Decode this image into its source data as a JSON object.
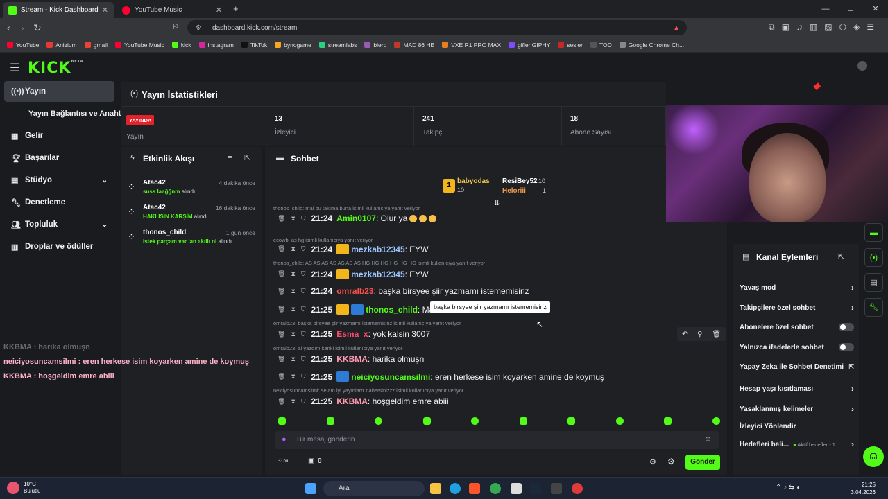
{
  "browser": {
    "tabs": [
      {
        "label": "Stream - Kick Dashboard",
        "active": true
      },
      {
        "label": "YouTube Music",
        "active": false
      }
    ],
    "url": "dashboard.kick.com/stream",
    "bookmarks": [
      "YouTube",
      "Anizium",
      "gmail",
      "YouTube Music",
      "kick",
      "instagram",
      "TikTok",
      "bynogame",
      "streamlabs",
      "blerp",
      "MAD 86 HE",
      "VXE R1 PRO MAX",
      "gifler GIPHY",
      "sesler",
      "TOD",
      "Google Chrome Ch..."
    ]
  },
  "sidebar": {
    "items": [
      {
        "label": "Yayın",
        "icon": "broadcast-icon"
      },
      {
        "label": "Yayın Bağlantısı ve Anahtarı"
      },
      {
        "label": "Gelir",
        "icon": "chart-icon"
      },
      {
        "label": "Başarılar",
        "icon": "trophy-icon"
      },
      {
        "label": "Stüdyo",
        "icon": "studio-icon"
      },
      {
        "label": "Denetleme",
        "icon": "wrench-icon"
      },
      {
        "label": "Topluluk",
        "icon": "users-icon"
      },
      {
        "label": "Droplar ve ödüller",
        "icon": "drops-icon"
      }
    ]
  },
  "stats": {
    "title": "Yayın İstatistikleri",
    "live_badge": "YAYINDA",
    "live_label": "Yayın",
    "viewers_value": "13",
    "viewers_label": "İzleyici",
    "followers_value": "241",
    "followers_label": "Takipçi",
    "subs_value": "18",
    "subs_label": "Abone Sayısı"
  },
  "events": {
    "title": "Etkinlik Akışı",
    "items": [
      {
        "user": "Atac42",
        "time": "4 dakika önce",
        "reward": "suss laağğnm",
        "suffix": "alındı"
      },
      {
        "user": "Atac42",
        "time": "16 dakika önce",
        "reward": "HAKLISIN KARŞİM",
        "suffix": "alındı"
      },
      {
        "user": "thonos_child",
        "time": "1 gün önce",
        "reward": "istek parçam var lan akıllı ol",
        "suffix": "alındı"
      }
    ]
  },
  "chat": {
    "title": "Sohbet",
    "top": {
      "first": "babyodas",
      "first_count": "10",
      "second": "ResiBey52",
      "second_count": "10",
      "third": "Heloriii",
      "third_count": "1"
    },
    "lines": [
      {
        "reply": "thonos_child: mal bu takıma buna isimli kullanıcıya yanıt veriyor",
        "time": "21:24",
        "user": "Amin0107",
        "text": ": Olur ya",
        "color": "#53fc18"
      },
      {
        "reply": "ecowb: as hg isimli kullanıcıya yanıt veriyor",
        "time": "21:24",
        "user": "mezkab12345",
        "text": ": EYW",
        "color": "#9ec7ff"
      },
      {
        "reply": "thonos_child: AS AS AS AS AS AS AS HG HG HG HG HG HG isimli kullanıcıya yanıt veriyor",
        "time": "21:24",
        "user": "mezkab12345",
        "text": ": EYW",
        "color": "#9ec7ff"
      },
      {
        "reply": "",
        "time": "21:24",
        "user": "omralb23",
        "text": ": başka birsyee şiir yazmamı istememisinz",
        "color": "#ff4d4d"
      },
      {
        "reply": "",
        "time": "21:25",
        "user": "thonos_child",
        "text": ": Mals",
        "color": "#53fc18"
      },
      {
        "reply": "omralb23: başka birsyee şiir yazmamı istememisinz isimli kullanıcıya yanıt veriyor",
        "time": "21:25",
        "user": "Esma_x",
        "text": ": yok kalsin 3007",
        "color": "#ff4d6d"
      },
      {
        "reply": "omralb23: al yazdım kanki isimli kullanıcıya yanıt veriyor",
        "time": "21:25",
        "user": "KKBMA",
        "text": ": harika olmuşn",
        "color": "#ff9ab3"
      },
      {
        "reply": "",
        "time": "21:25",
        "user": "neiciyosuncamsilmi",
        "text": ": eren herkese isim koyarken amine de koymuş",
        "color": "#53fc18"
      },
      {
        "reply": "neiciyosuncamsilmi: selam iyi yayınlarrr nabersinizzz isimli kullanıcıya yanıt veriyor",
        "time": "21:25",
        "user": "KKBMA",
        "text": ": hoşgeldim emre abiii",
        "color": "#ff9ab3"
      }
    ],
    "tooltip": "başka birsyee şiir yazmamı istememisinz",
    "input_placeholder": "Bir mesaj gönderin",
    "send_label": "Gönder",
    "footer_count": "0"
  },
  "actions": {
    "title": "Kanal Eylemleri",
    "items": [
      {
        "label": "Yavaş mod",
        "control": "chevron"
      },
      {
        "label": "Takipçilere özel sohbet",
        "control": "chevron"
      },
      {
        "label": "Abonelere özel sohbet",
        "control": "toggle"
      },
      {
        "label": "Yalnızca ifadelerle sohbet",
        "control": "toggle"
      },
      {
        "label": "Yapay Zeka ile Sohbet Denetimi",
        "control": "external"
      },
      {
        "label": "Hesap yaşı kısıtlaması",
        "control": "chevron"
      },
      {
        "label": "Yasaklanmış kelimeler",
        "control": "chevron"
      },
      {
        "label": "İzleyici Yönlendir",
        "control": "none"
      },
      {
        "label": "Hedefleri beli...",
        "control": "chevron"
      }
    ],
    "goals_status": "Aktif hedefler - 1"
  },
  "overlay_chat": [
    {
      "text": "KKBMA : harika olmuşn"
    },
    {
      "text": "neiciyosuncamsilmi : eren herkese isim koyarken amine de koymuş"
    },
    {
      "text": "KKBMA : hoşgeldim emre abiii"
    }
  ],
  "taskbar": {
    "weather_temp": "10°C",
    "weather_desc": "Bulutlu",
    "search": "Ara",
    "time": "21:25",
    "date": "3.04.2026"
  },
  "colors": {
    "accent": "#53fc18",
    "live": "#e3222c"
  }
}
